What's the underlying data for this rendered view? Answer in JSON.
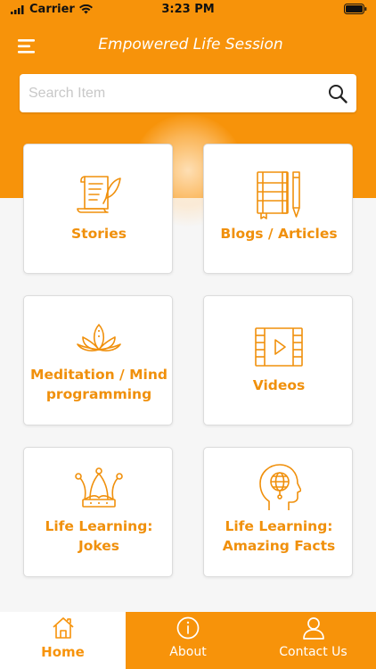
{
  "status_bar": {
    "carrier": "Carrier",
    "time": "3:23 PM"
  },
  "header": {
    "title": "Empowered Life Session",
    "menu_icon": "hamburger-menu-icon"
  },
  "search": {
    "placeholder": "Search Item",
    "value": "",
    "icon": "search-icon"
  },
  "categories": [
    {
      "label_line1": "Stories",
      "label_line2": "",
      "icon": "scroll-quill-icon"
    },
    {
      "label_line1": "Blogs / Articles",
      "label_line2": "",
      "icon": "notebook-pencil-icon"
    },
    {
      "label_line1": "Meditation / Mind",
      "label_line2": "programming",
      "icon": "lotus-icon"
    },
    {
      "label_line1": "Videos",
      "label_line2": "",
      "icon": "film-play-icon"
    },
    {
      "label_line1": "Life Learning:",
      "label_line2": "Jokes",
      "icon": "jester-hat-icon"
    },
    {
      "label_line1": "Life Learning:",
      "label_line2": "Amazing Facts",
      "icon": "head-globe-icon"
    }
  ],
  "tabbar": {
    "home": "Home",
    "about": "About",
    "contact": "Contact Us",
    "active": "Home"
  },
  "colors": {
    "accent": "#f7930a",
    "label": "#f0900c",
    "background": "#f6f6f6"
  }
}
